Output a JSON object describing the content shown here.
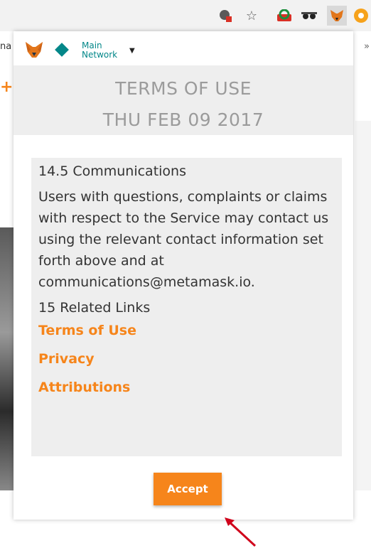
{
  "browser": {
    "left_fragment": "na",
    "right_fragment": "»"
  },
  "network": {
    "label_line1": "Main",
    "label_line2": "Network",
    "color": "#038789"
  },
  "terms": {
    "title": "TERMS OF USE",
    "date": "THU FEB 09 2017"
  },
  "content": {
    "section_heading": "14.5 Communications",
    "section_body": "Users with questions, complaints or claims with respect to the Service may contact us using the relevant contact information set forth above and at communications@metamask.io.",
    "related_heading": "15 Related Links",
    "links": [
      "Terms of Use",
      "Privacy",
      "Attributions"
    ]
  },
  "accept": {
    "label": "Accept"
  },
  "colors": {
    "accent": "#f6851b",
    "band": "#eeeeee",
    "muted_text": "#9b9b9b"
  },
  "icons": [
    "translate-icon",
    "star-icon",
    "extension-icon",
    "incognito-icon",
    "metamask-fox-icon",
    "user-circle-icon"
  ]
}
